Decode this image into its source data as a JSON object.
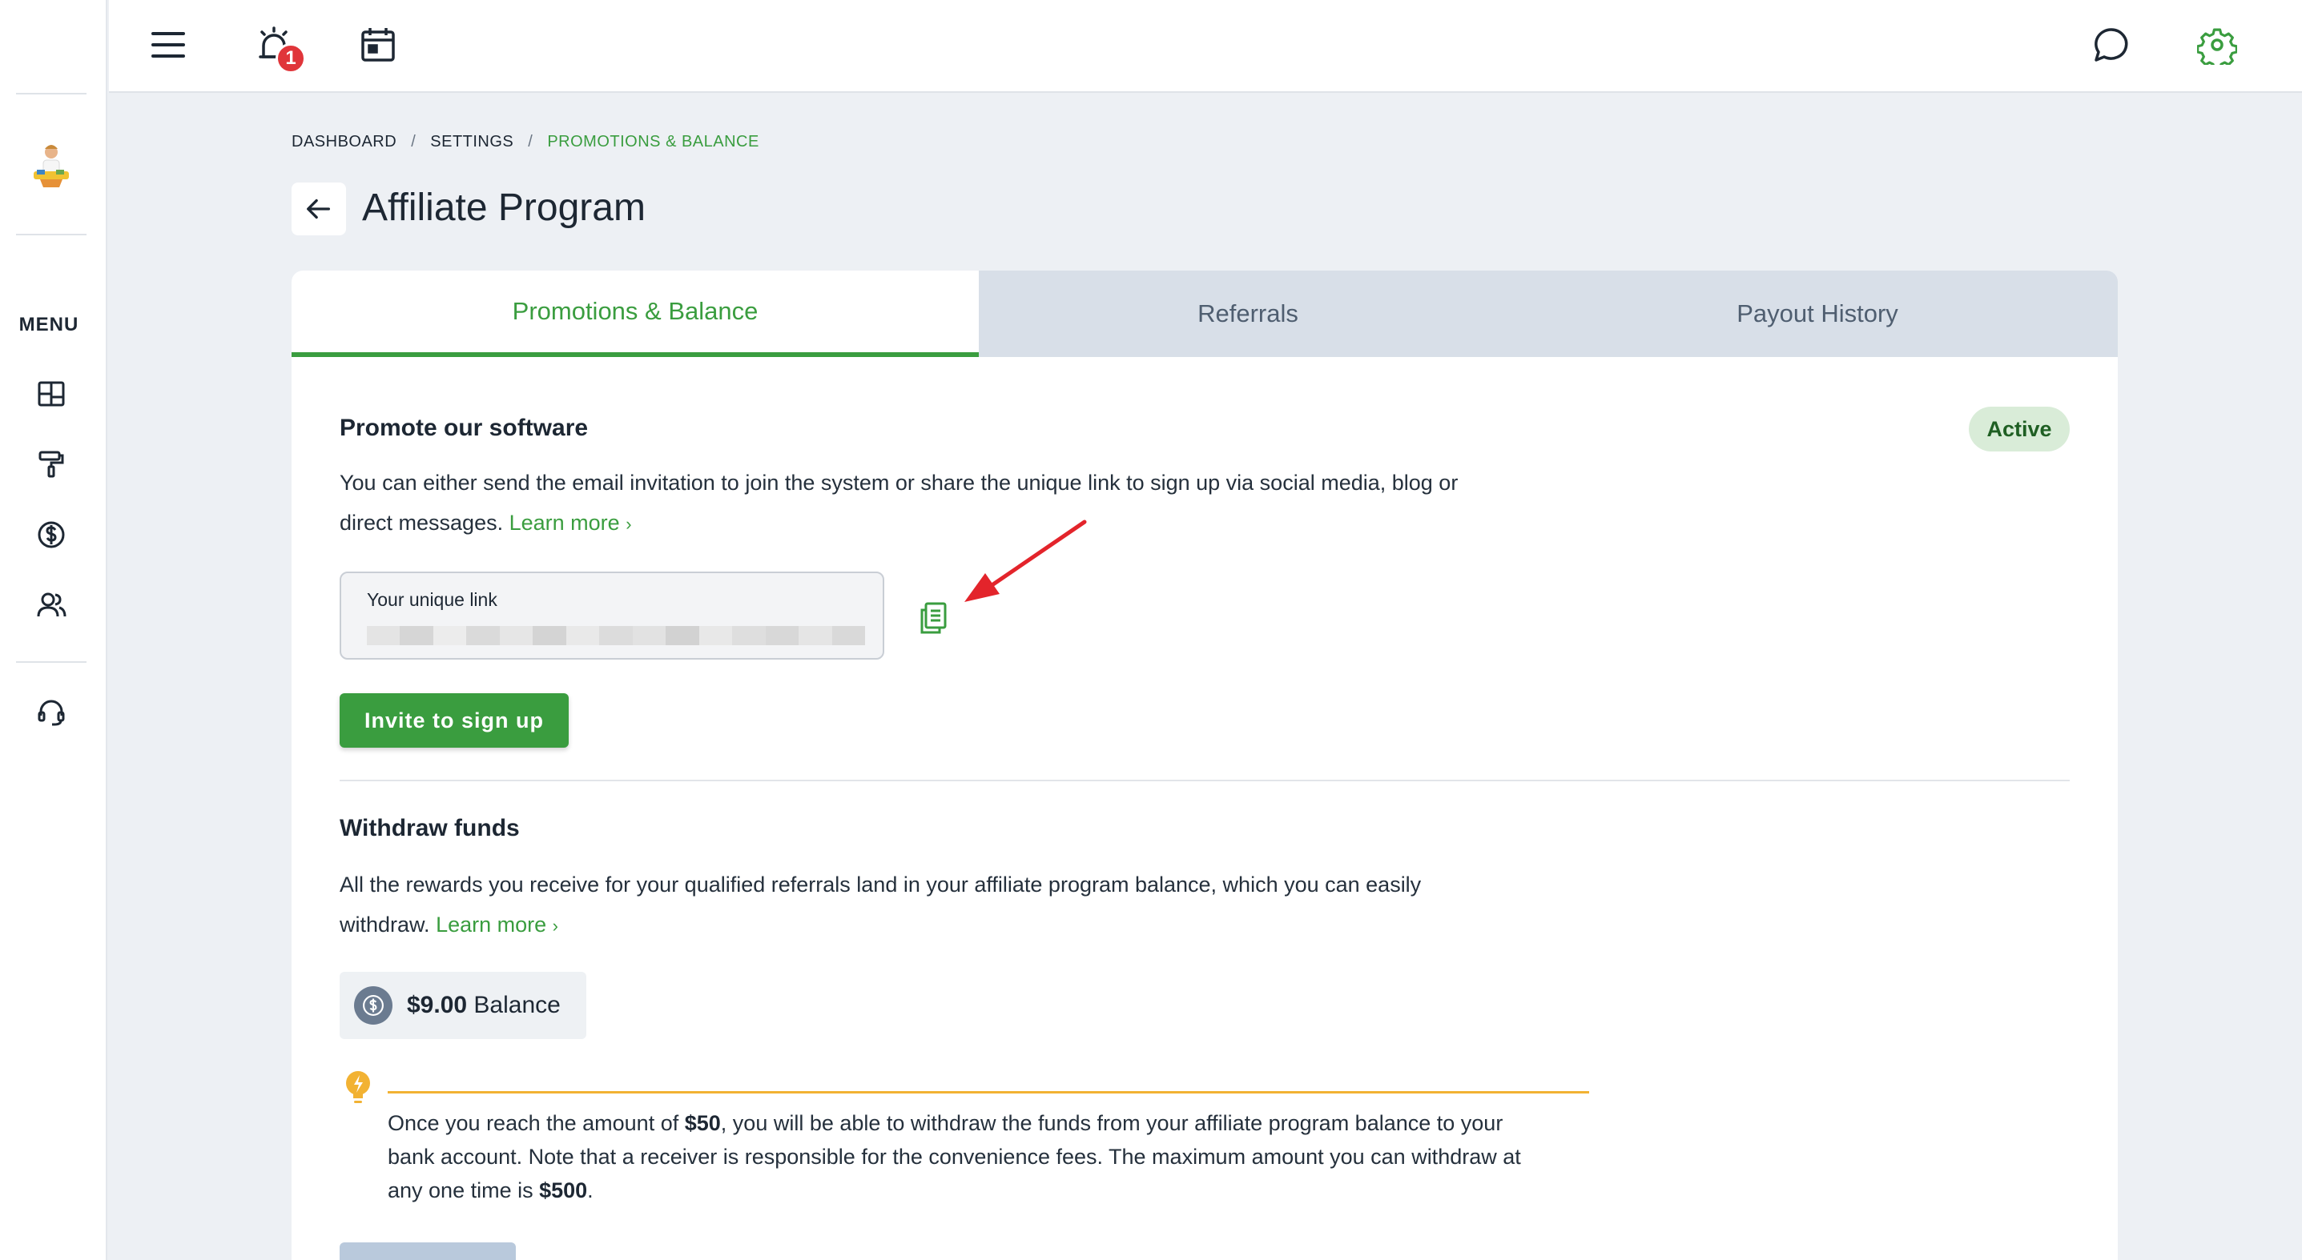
{
  "topbar": {
    "notification_count": "1"
  },
  "sidebar": {
    "menu_label": "MENU"
  },
  "breadcrumb": {
    "items": [
      "DASHBOARD",
      "SETTINGS",
      "PROMOTIONS & BALANCE"
    ],
    "separator": "/"
  },
  "page": {
    "title": "Affiliate Program"
  },
  "tabs": [
    {
      "label": "Promotions & Balance",
      "active": true
    },
    {
      "label": "Referrals",
      "active": false
    },
    {
      "label": "Payout History",
      "active": false
    }
  ],
  "promote": {
    "title": "Promote our software",
    "status": "Active",
    "description": "You can either send the email invitation to join the system or share the unique link to sign up via social media, blog or direct messages.",
    "learn_more": "Learn more",
    "link_label": "Your unique link",
    "invite_button": "Invite to sign up"
  },
  "withdraw": {
    "title": "Withdraw funds",
    "description": "All the rewards you receive for your qualified referrals land in your affiliate program balance, which you can easily withdraw.",
    "learn_more": "Learn more",
    "balance_amount": "$9.00",
    "balance_label": "Balance",
    "tip_part1": "Once you reach the amount of ",
    "tip_min": "$50",
    "tip_part2": ", you will be able to withdraw the funds from your affiliate program balance to your bank account. Note that a receiver is responsible for the convenience fees. The maximum amount you can withdraw at any one time is ",
    "tip_max": "$500",
    "tip_part3": "."
  },
  "colors": {
    "accent": "#3a9d3f",
    "badge_bg": "#d9ecd8",
    "notification": "#e0353a",
    "tip": "#f2b233",
    "annotation": "#e3242b"
  }
}
